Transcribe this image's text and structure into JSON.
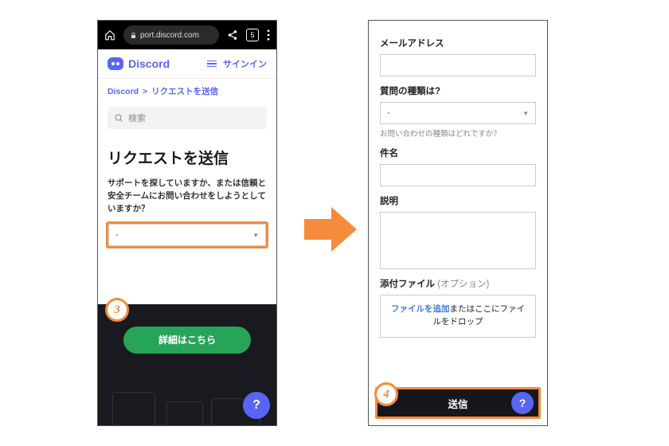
{
  "browser": {
    "url_text": "port.discord.com",
    "tab_count": "5"
  },
  "header": {
    "brand": "Discord",
    "signin": "サインイン"
  },
  "breadcrumb": {
    "root": "Discord",
    "sep": ">",
    "current": "リクエストを送信"
  },
  "search": {
    "placeholder": "検索"
  },
  "page": {
    "title": "リクエストを送信",
    "question": "サポートを探していますか、または信頼と安全チームにお問い合わせをしようとしていますか？",
    "select_value": "-"
  },
  "footer": {
    "details_btn": "詳細はこちら",
    "help_glyph": "?"
  },
  "form": {
    "email_label": "メールアドレス",
    "qtype_label": "質問の種類は?",
    "qtype_value": "-",
    "qtype_hint": "お問い合わせの種類はどれですか？",
    "subject_label": "件名",
    "desc_label": "説明",
    "attach_label": "添付ファイル",
    "attach_opt": "(オプション)",
    "attach_add": "ファイルを追加",
    "attach_rest": "またはここにファイルをドロップ",
    "submit": "送信",
    "help_glyph": "?"
  },
  "badges": {
    "three": "3",
    "four": "4"
  }
}
